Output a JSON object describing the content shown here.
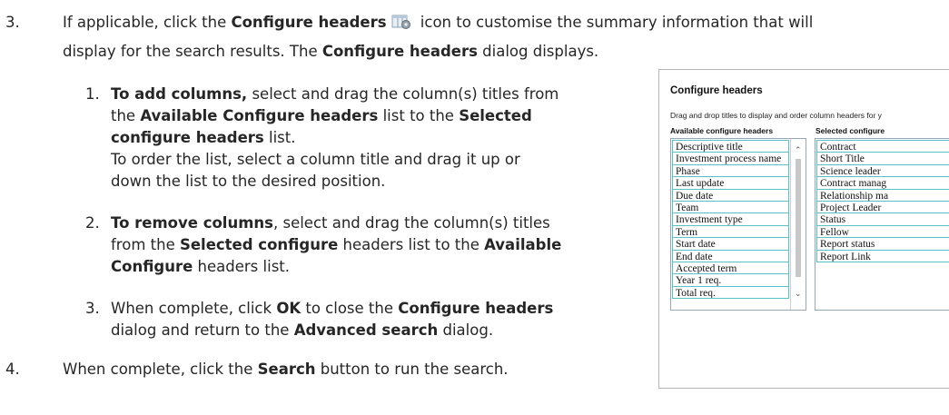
{
  "steps": {
    "step3": {
      "number": "3.",
      "line1_prefix": "If applicable, click the ",
      "line1_bold": "Configure headers",
      "line1_suffix": " icon to customise the summary information that will",
      "line2_prefix": "display for the search results.  The ",
      "line2_bold": "Configure headers",
      "line2_suffix": " dialog displays."
    },
    "sub1": {
      "number": "1.",
      "l1_bold": "To add columns,",
      "l1_text": " select and drag the column(s) titles from",
      "l2_a": "the ",
      "l2_bold": "Available Configure headers",
      "l2_b": " list to the ",
      "l2_bold2": "Selected",
      "l3_bold": "configure headers",
      "l3_text": " list.",
      "l4": "To order the list, select a column title and drag it up or",
      "l5": "down the list to the desired position."
    },
    "sub2": {
      "number": "2.",
      "l1_bold": "To remove columns",
      "l1_text": ", select and drag the column(s) titles",
      "l2_a": "from the ",
      "l2_bold": "Selected configure",
      "l2_b": " headers list to the ",
      "l2_bold2": "Available",
      "l3_bold": "Configure",
      "l3_text": " headers list."
    },
    "sub3": {
      "number": "3.",
      "l1_a": "When complete, click ",
      "l1_bold": "OK",
      "l1_b": " to close the ",
      "l1_bold2": "Configure headers",
      "l2_a": "dialog and return to the ",
      "l2_bold": "Advanced search",
      "l2_b": " dialog."
    },
    "step4": {
      "number": "4.",
      "a": "When complete, click the ",
      "bold": "Search",
      "b": " button to run the search."
    }
  },
  "dialog": {
    "title": "Configure headers",
    "instruction": "Drag and drop titles to display and order column headers for y",
    "available_header": "Available configure headers",
    "selected_header": "Selected configure",
    "available_items": [
      "Descriptive title",
      "Investment process name",
      "Phase",
      "Last update",
      "Due date",
      "Team",
      "Investment type",
      "Term",
      "Start date",
      "End date",
      "Accepted term",
      "Year 1 req.",
      "Total req."
    ],
    "selected_items": [
      "Contract",
      "Short Title",
      "Science leader",
      "Contract manag",
      "Relationship ma",
      "Project Leader",
      "Status",
      "Fellow",
      "Report status",
      "Report Link"
    ]
  },
  "icons": {
    "configure_headers": "gear-icon"
  }
}
